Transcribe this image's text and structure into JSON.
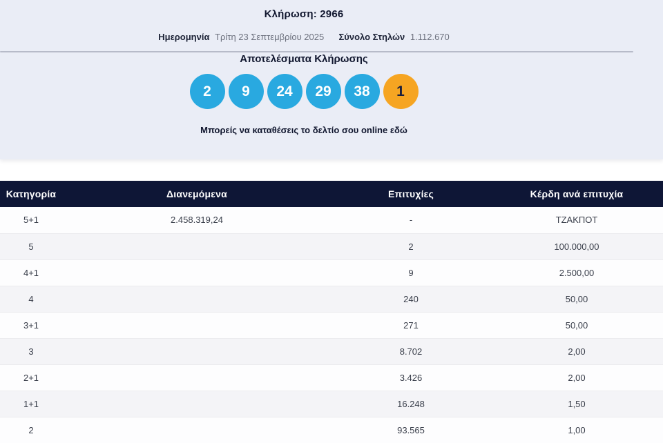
{
  "header": {
    "draw_label": "Κλήρωση: 2966",
    "date_label": "Ημερομηνία",
    "date_value": "Τρίτη 23 Σεπτεμβρίου 2025",
    "columns_label": "Σύνολο Στηλών",
    "columns_value": "1.112.670"
  },
  "results": {
    "title": "Αποτελέσματα Κλήρωσης",
    "numbers": [
      "2",
      "9",
      "24",
      "29",
      "38"
    ],
    "joker": "1",
    "deposit_text": "Μπορείς να καταθέσεις το δελτίο σου online εδώ"
  },
  "table": {
    "headers": [
      "Κατηγορία",
      "Διανεμόμενα",
      "Επιτυχίες",
      "Κέρδη ανά επιτυχία"
    ],
    "rows": [
      {
        "category": "5+1",
        "distributed": "2.458.319,24",
        "winners": "-",
        "prize": "ΤΖΑΚΠΟΤ"
      },
      {
        "category": "5",
        "distributed": "",
        "winners": "2",
        "prize": "100.000,00"
      },
      {
        "category": "4+1",
        "distributed": "",
        "winners": "9",
        "prize": "2.500,00"
      },
      {
        "category": "4",
        "distributed": "",
        "winners": "240",
        "prize": "50,00"
      },
      {
        "category": "3+1",
        "distributed": "",
        "winners": "271",
        "prize": "50,00"
      },
      {
        "category": "3",
        "distributed": "",
        "winners": "8.702",
        "prize": "2,00"
      },
      {
        "category": "2+1",
        "distributed": "",
        "winners": "3.426",
        "prize": "2,00"
      },
      {
        "category": "1+1",
        "distributed": "",
        "winners": "16.248",
        "prize": "1,50"
      },
      {
        "category": "2",
        "distributed": "",
        "winners": "93.565",
        "prize": "1,00"
      }
    ]
  },
  "colors": {
    "number_ball": "#29a9e0",
    "joker_ball": "#f6a522",
    "table_header_bg": "#0e1636",
    "panel_bg": "#eaedf6"
  }
}
